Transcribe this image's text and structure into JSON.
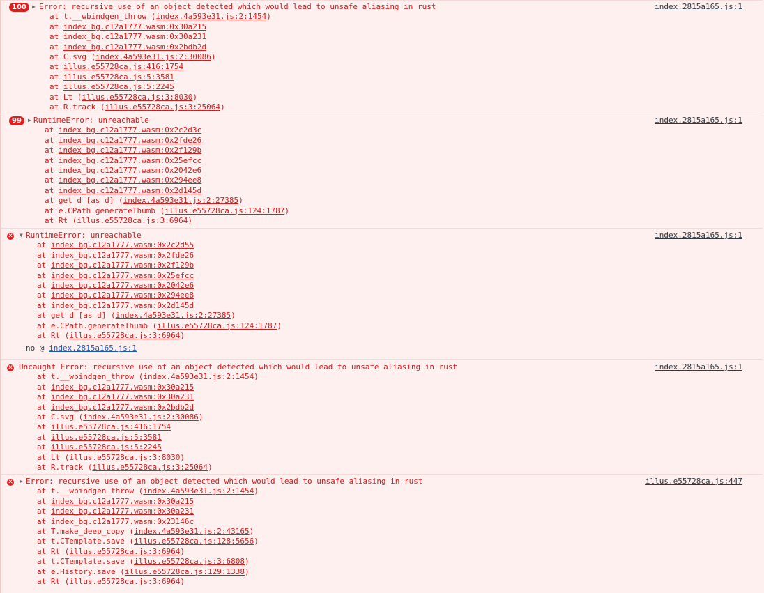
{
  "entries": [
    {
      "badge": "100",
      "caret": "▶",
      "message": "Error: recursive use of an object detected which would lead to unsafe aliasing in rust",
      "source": "index.2815a165.js:1",
      "frames": [
        {
          "fn": "t.__wbindgen_throw",
          "loc": "index.4a593e31.js:2:1454",
          "paren": true
        },
        {
          "fn": "",
          "loc": "index_bg.c12a1777.wasm:0x30a215",
          "paren": false
        },
        {
          "fn": "",
          "loc": "index_bg.c12a1777.wasm:0x30a231",
          "paren": false
        },
        {
          "fn": "",
          "loc": "index_bg.c12a1777.wasm:0x2bdb2d",
          "paren": false
        },
        {
          "fn": "C.svg",
          "loc": "index.4a593e31.js:2:30086",
          "paren": true
        },
        {
          "fn": "",
          "loc": "illus.e55728ca.js:416:1754",
          "paren": false
        },
        {
          "fn": "",
          "loc": "illus.e55728ca.js:5:3581",
          "paren": false
        },
        {
          "fn": "",
          "loc": "illus.e55728ca.js:5:2245",
          "paren": false
        },
        {
          "fn": "Lt",
          "loc": "illus.e55728ca.js:3:8030",
          "paren": true
        },
        {
          "fn": "R.track",
          "loc": "illus.e55728ca.js:3:25064",
          "paren": true
        }
      ]
    },
    {
      "badge": "99",
      "caret": "▶",
      "message": "RuntimeError: unreachable",
      "source": "index.2815a165.js:1",
      "frames": [
        {
          "fn": "",
          "loc": "index_bg.c12a1777.wasm:0x2c2d3c",
          "paren": false
        },
        {
          "fn": "",
          "loc": "index_bg.c12a1777.wasm:0x2fde26",
          "paren": false
        },
        {
          "fn": "",
          "loc": "index_bg.c12a1777.wasm:0x2f129b",
          "paren": false
        },
        {
          "fn": "",
          "loc": "index_bg.c12a1777.wasm:0x25efcc",
          "paren": false
        },
        {
          "fn": "",
          "loc": "index_bg.c12a1777.wasm:0x2042e6",
          "paren": false
        },
        {
          "fn": "",
          "loc": "index_bg.c12a1777.wasm:0x294ee8",
          "paren": false
        },
        {
          "fn": "",
          "loc": "index_bg.c12a1777.wasm:0x2d145d",
          "paren": false
        },
        {
          "fn": "get d [as d]",
          "loc": "index.4a593e31.js:2:27385",
          "paren": true
        },
        {
          "fn": "e.CPath.generateThumb",
          "loc": "illus.e55728ca.js:124:1787",
          "paren": true
        },
        {
          "fn": "Rt",
          "loc": "illus.e55728ca.js:3:6964",
          "paren": true
        }
      ]
    },
    {
      "icon": "✕",
      "caret": "▼",
      "message": "RuntimeError: unreachable",
      "source": "index.2815a165.js:1",
      "frames": [
        {
          "fn": "",
          "loc": "index_bg.c12a1777.wasm:0x2c2d55",
          "paren": false
        },
        {
          "fn": "",
          "loc": "index_bg.c12a1777.wasm:0x2fde26",
          "paren": false
        },
        {
          "fn": "",
          "loc": "index_bg.c12a1777.wasm:0x2f129b",
          "paren": false
        },
        {
          "fn": "",
          "loc": "index_bg.c12a1777.wasm:0x25efcc",
          "paren": false
        },
        {
          "fn": "",
          "loc": "index_bg.c12a1777.wasm:0x2042e6",
          "paren": false
        },
        {
          "fn": "",
          "loc": "index_bg.c12a1777.wasm:0x294ee8",
          "paren": false
        },
        {
          "fn": "",
          "loc": "index_bg.c12a1777.wasm:0x2d145d",
          "paren": false
        },
        {
          "fn": "get d [as d]",
          "loc": "index.4a593e31.js:2:27385",
          "paren": true
        },
        {
          "fn": "e.CPath.generateThumb",
          "loc": "illus.e55728ca.js:124:1787",
          "paren": true
        },
        {
          "fn": "Rt",
          "loc": "illus.e55728ca.js:3:6964",
          "paren": true
        }
      ],
      "footer_prefix": "no @ ",
      "footer_link": "index.2815a165.js:1"
    },
    {
      "icon": "✕",
      "message": "Uncaught Error: recursive use of an object detected which would lead to unsafe aliasing in rust",
      "source": "index.2815a165.js:1",
      "frames": [
        {
          "fn": "t.__wbindgen_throw",
          "loc": "index.4a593e31.js:2:1454",
          "paren": true
        },
        {
          "fn": "",
          "loc": "index_bg.c12a1777.wasm:0x30a215",
          "paren": false
        },
        {
          "fn": "",
          "loc": "index_bg.c12a1777.wasm:0x30a231",
          "paren": false
        },
        {
          "fn": "",
          "loc": "index_bg.c12a1777.wasm:0x2bdb2d",
          "paren": false
        },
        {
          "fn": "C.svg",
          "loc": "index.4a593e31.js:2:30086",
          "paren": true
        },
        {
          "fn": "",
          "loc": "illus.e55728ca.js:416:1754",
          "paren": false
        },
        {
          "fn": "",
          "loc": "illus.e55728ca.js:5:3581",
          "paren": false
        },
        {
          "fn": "",
          "loc": "illus.e55728ca.js:5:2245",
          "paren": false
        },
        {
          "fn": "Lt",
          "loc": "illus.e55728ca.js:3:8030",
          "paren": true
        },
        {
          "fn": "R.track",
          "loc": "illus.e55728ca.js:3:25064",
          "paren": true
        }
      ]
    },
    {
      "icon": "✕",
      "caret": "▶",
      "message": "Error: recursive use of an object detected which would lead to unsafe aliasing in rust",
      "source": "illus.e55728ca.js:447",
      "frames": [
        {
          "fn": "t.__wbindgen_throw",
          "loc": "index.4a593e31.js:2:1454",
          "paren": true
        },
        {
          "fn": "",
          "loc": "index_bg.c12a1777.wasm:0x30a215",
          "paren": false
        },
        {
          "fn": "",
          "loc": "index_bg.c12a1777.wasm:0x30a231",
          "paren": false
        },
        {
          "fn": "",
          "loc": "index_bg.c12a1777.wasm:0x23146c",
          "paren": false
        },
        {
          "fn": "T.make_deep_copy",
          "loc": "index.4a593e31.js:2:43165",
          "paren": true
        },
        {
          "fn": "t.CTemplate.save",
          "loc": "illus.e55728ca.js:128:5656",
          "paren": true
        },
        {
          "fn": "Rt",
          "loc": "illus.e55728ca.js:3:6964",
          "paren": true
        },
        {
          "fn": "t.CTemplate.save",
          "loc": "illus.e55728ca.js:3:6808",
          "paren": true
        },
        {
          "fn": "e.History.save",
          "loc": "illus.e55728ca.js:129:1338",
          "paren": true
        },
        {
          "fn": "Rt",
          "loc": "illus.e55728ca.js:3:6964",
          "paren": true
        }
      ]
    }
  ],
  "labels": {
    "at": "at "
  },
  "colors": {
    "error_red": "#d81b1b",
    "background": "#fff0f0",
    "badge_red": "#e11d1d",
    "link_blue": "#1a55c9"
  }
}
